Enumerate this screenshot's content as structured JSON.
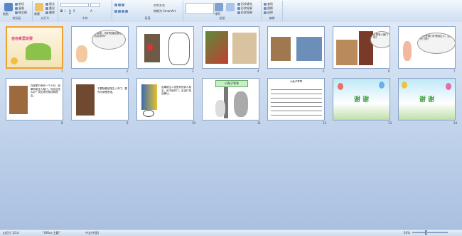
{
  "ribbon": {
    "groups": [
      {
        "label": "剪贴板"
      },
      {
        "label": "幻灯片"
      },
      {
        "label": "字体"
      },
      {
        "label": "段落"
      },
      {
        "label": "绘图"
      },
      {
        "label": "编辑"
      }
    ],
    "clipboard": {
      "paste": "粘贴",
      "cut": "剪切",
      "copy": "复制",
      "format": "格式刷"
    },
    "slides": {
      "new": "新建",
      "new2": "幻灯片",
      "layout": "版式",
      "reset": "重设",
      "delete": "删除"
    },
    "paragraph": {
      "smartart": "转换为 SmartArt",
      "align": "对齐文本"
    },
    "drawing": {
      "arrange": "排列",
      "quick": "快速样式",
      "fill": "形状填充",
      "outline": "形状轮廓",
      "effect": "形状效果"
    },
    "editing": {
      "find": "查找",
      "replace": "替换",
      "select": "选择"
    }
  },
  "slides": [
    {
      "num": "1",
      "title": "自在家里玩耍",
      "selected": true
    },
    {
      "num": "2",
      "bubble": "小朋友，你们知道这首歌的名字吗？"
    },
    {
      "num": "3"
    },
    {
      "num": "4"
    },
    {
      "num": "5"
    },
    {
      "num": "6",
      "bubble": "这里有人敲门吗？"
    },
    {
      "num": "7",
      "bubble": "你们觉得门外有陌生人，应该开门吗？"
    },
    {
      "num": "8",
      "text": "在家里只有你一个人时，如果有陌生人敲门，你应该怎么办？说出你的想法和理由。"
    },
    {
      "num": "9",
      "text": "不要随便给陌生人开门，要先问清楚是谁。"
    },
    {
      "num": "10",
      "text": "如果陌生人说是你的家人朋友，也不能开门，应该打电话确认。"
    },
    {
      "num": "11",
      "title": "小兔子乖乖"
    },
    {
      "num": "12",
      "title": "小兔子乖乖"
    },
    {
      "num": "13",
      "title": "谢 谢"
    },
    {
      "num": "14",
      "title": "谢 谢"
    }
  ],
  "status": {
    "slide": "幻灯片 1/14",
    "theme": "\"Office 主题\"",
    "lang": "中文(中国)",
    "zoom": "50%"
  }
}
